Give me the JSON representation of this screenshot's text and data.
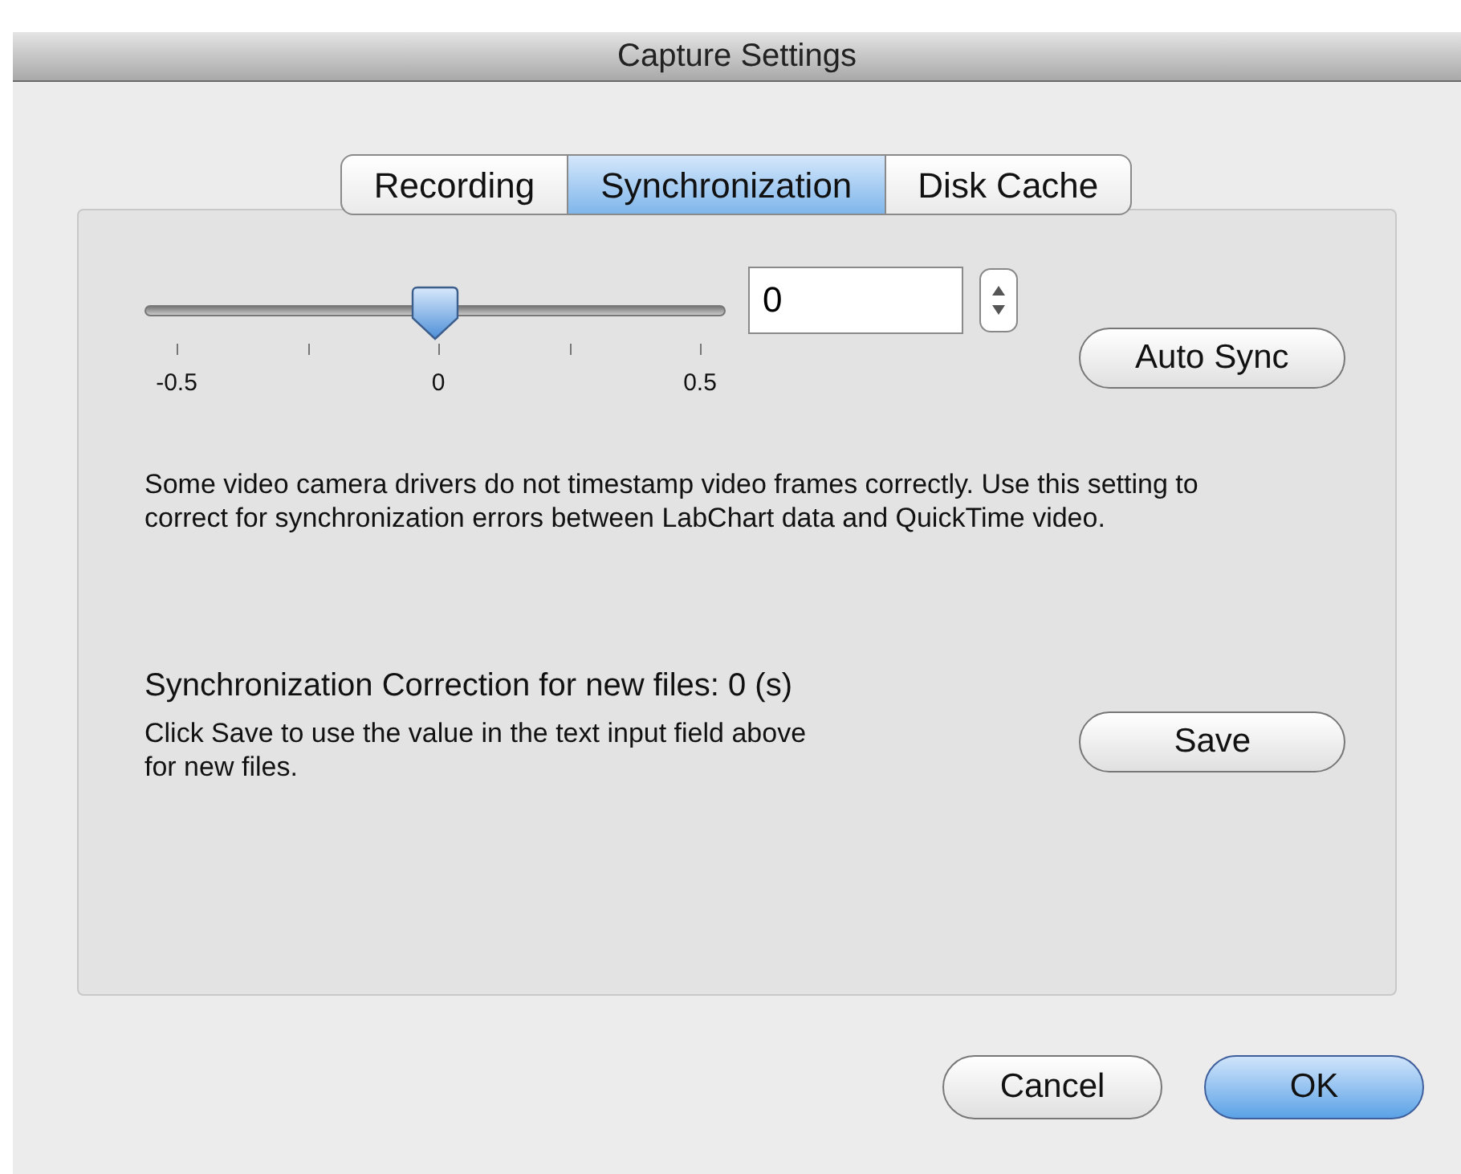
{
  "window": {
    "title": "Capture Settings"
  },
  "tabs": [
    {
      "label": "Recording",
      "selected": false
    },
    {
      "label": "Synchronization",
      "selected": true
    },
    {
      "label": "Disk Cache",
      "selected": false
    }
  ],
  "slider": {
    "level": 0.5,
    "tick_labels": [
      "-0.5",
      "0",
      "0.5"
    ]
  },
  "offset_field": {
    "value": "0"
  },
  "auto_sync_button": "Auto Sync",
  "description": "Some video camera drivers do not timestamp video frames correctly. Use this setting to correct for synchronization errors between LabChart data and QuickTime video.",
  "correction_heading": "Synchronization Correction for new files: 0 (s)",
  "save_hint": "Click Save to use the value in the text input field above for new files.",
  "save_button": "Save",
  "buttons": [
    {
      "label": "Cancel",
      "kind": "normal"
    },
    {
      "label": "OK",
      "kind": "default"
    }
  ]
}
